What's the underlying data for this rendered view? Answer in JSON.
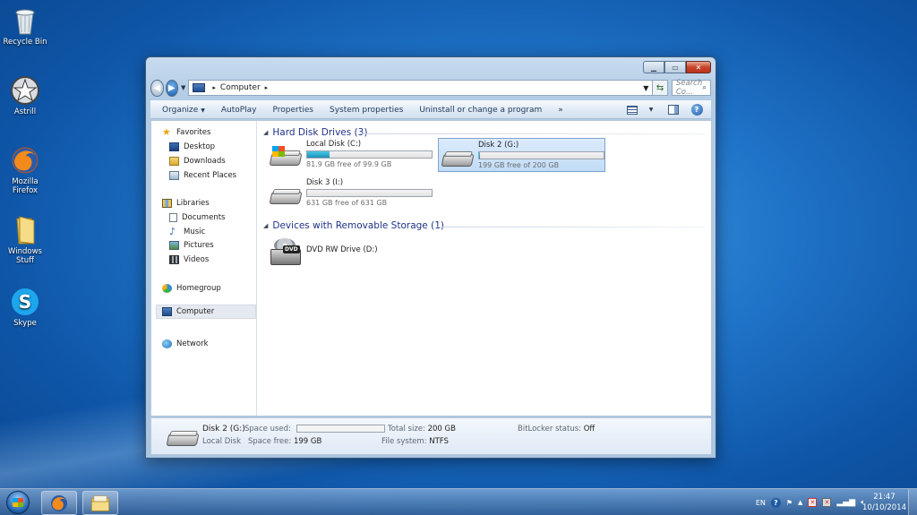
{
  "desktop": {
    "icons": [
      {
        "label": "Recycle Bin"
      },
      {
        "label": "Astrill"
      },
      {
        "label": "Mozilla Firefox"
      },
      {
        "label": "Windows Stuff"
      },
      {
        "label": "Skype"
      }
    ]
  },
  "window": {
    "address": {
      "location": "Computer"
    },
    "search": {
      "placeholder": "Search Co..."
    },
    "toolbar": {
      "organize": "Organize",
      "autoplay": "AutoPlay",
      "properties": "Properties",
      "system_properties": "System properties",
      "uninstall": "Uninstall or change a program",
      "more": "»"
    },
    "nav": {
      "favorites": "Favorites",
      "desktop": "Desktop",
      "downloads": "Downloads",
      "recent_places": "Recent Places",
      "libraries": "Libraries",
      "documents": "Documents",
      "music": "Music",
      "pictures": "Pictures",
      "videos": "Videos",
      "homegroup": "Homegroup",
      "computer": "Computer",
      "network": "Network"
    },
    "groups": {
      "hdd": "Hard Disk Drives (3)",
      "removable": "Devices with Removable Storage (1)"
    },
    "drives": [
      {
        "name": "Local Disk (C:)",
        "free": "81.9 GB free of 99.9 GB",
        "used_fraction": 0.18
      },
      {
        "name": "Disk 2 (G:)",
        "free": "199 GB free of 200 GB",
        "used_fraction": 0.005
      },
      {
        "name": "Disk 3 (I:)",
        "free": "631 GB free of 631 GB",
        "used_fraction": 0.0
      }
    ],
    "dvd": {
      "name": "DVD RW Drive (D:)",
      "icon_label": "DVD"
    },
    "details": {
      "name": "Disk 2 (G:)",
      "type": "Local Disk",
      "space_used_label": "Space used:",
      "space_free_label": "Space free:",
      "space_free": "199 GB",
      "total_size_label": "Total size:",
      "total_size": "200 GB",
      "file_system_label": "File system:",
      "file_system": "NTFS",
      "bitlocker_label": "BitLocker status:",
      "bitlocker": "Off",
      "used_fraction": 0.005
    }
  },
  "taskbar": {
    "language": "EN",
    "time": "21:47",
    "date": "10/10/2014"
  }
}
